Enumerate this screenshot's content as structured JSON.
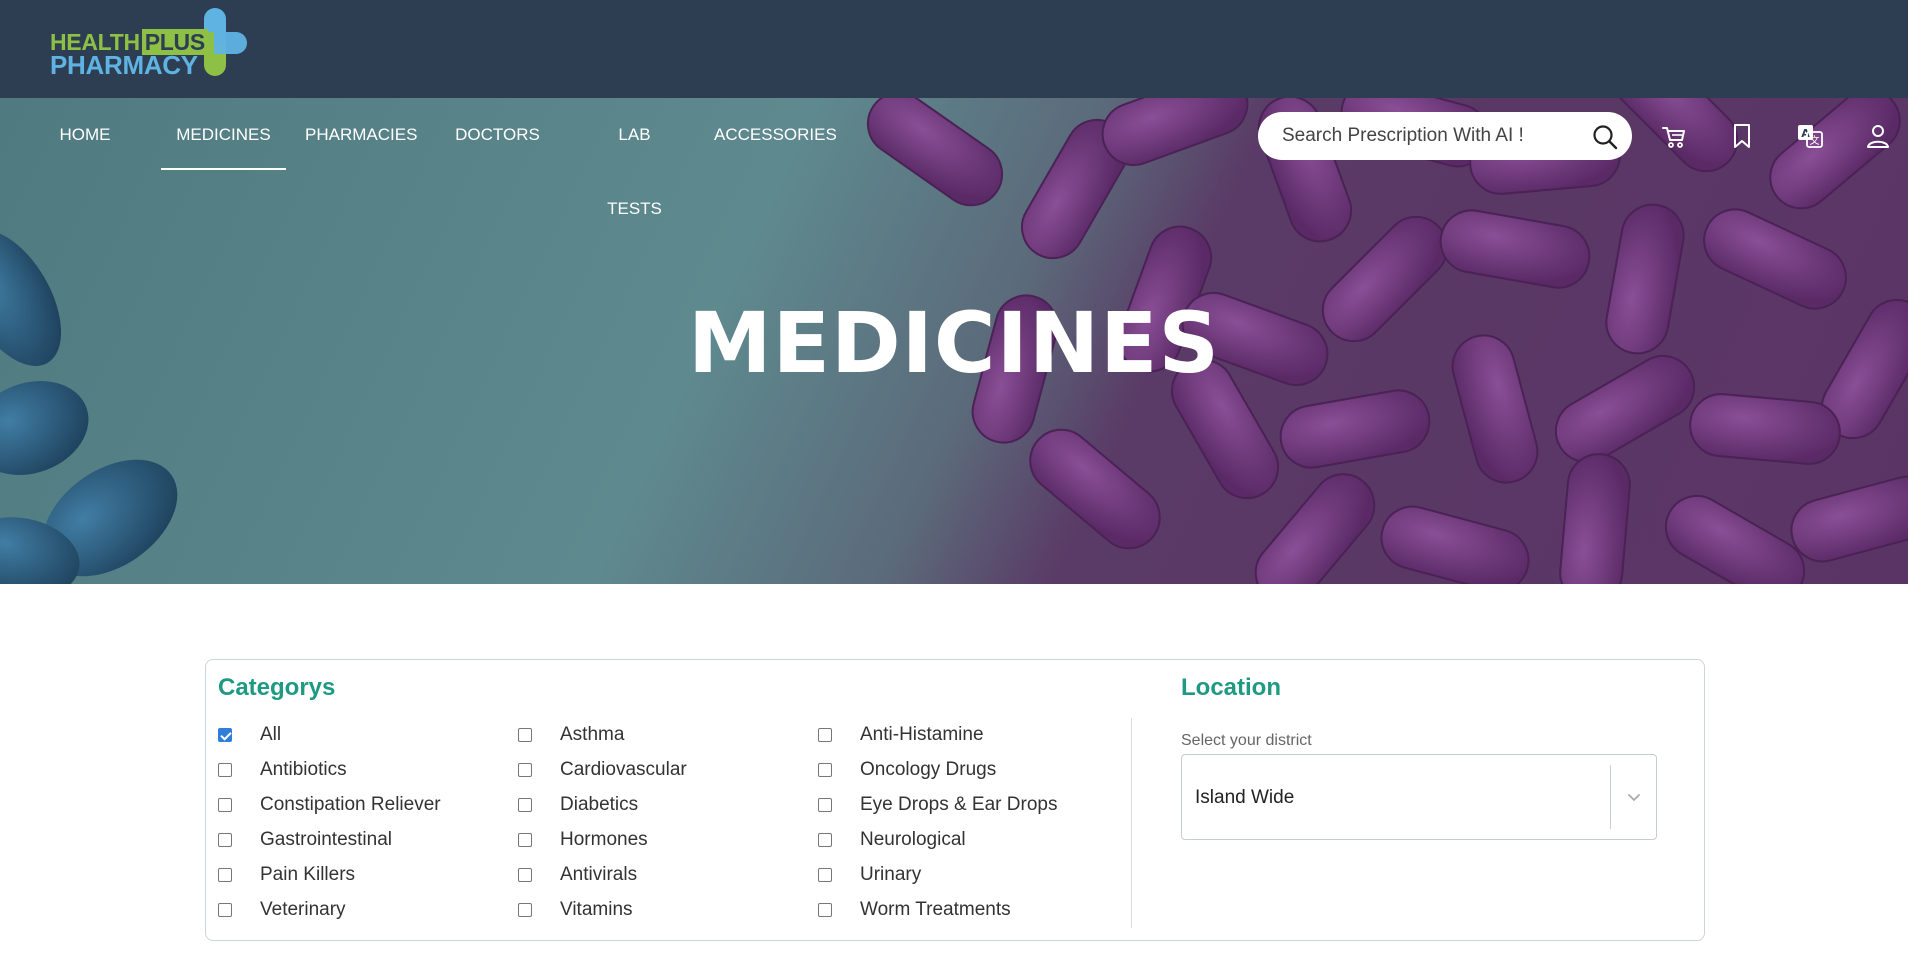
{
  "brand": {
    "line1": "HEALTH",
    "line1_box": "PLUS",
    "line2": "PHARMACY",
    "colors": {
      "green": "#8dc044",
      "blue": "#5fb3e3",
      "header_bg": "#2e3e52"
    }
  },
  "nav": {
    "items": [
      {
        "label": "HOME",
        "active": false
      },
      {
        "label": "MEDICINES",
        "active": true
      },
      {
        "label": "PHARMACIES",
        "active": false
      },
      {
        "label": "DOCTORS",
        "active": false
      },
      {
        "label": "LAB TESTS",
        "active": false
      },
      {
        "label": "ACCESSORIES",
        "active": false
      }
    ]
  },
  "search": {
    "placeholder": "Search Prescription With AI !",
    "icon": "search-icon"
  },
  "header_icons": [
    "cart-icon",
    "bookmark-icon",
    "translate-icon",
    "user-icon"
  ],
  "hero": {
    "title": "MEDICINES"
  },
  "filters": {
    "categories_title": "Categorys",
    "categories": [
      {
        "label": "All",
        "checked": true
      },
      {
        "label": "Antibiotics",
        "checked": false
      },
      {
        "label": "Constipation Reliever",
        "checked": false
      },
      {
        "label": "Gastrointestinal",
        "checked": false
      },
      {
        "label": "Pain Killers",
        "checked": false
      },
      {
        "label": "Veterinary",
        "checked": false
      },
      {
        "label": "Asthma",
        "checked": false
      },
      {
        "label": "Cardiovascular",
        "checked": false
      },
      {
        "label": "Diabetics",
        "checked": false
      },
      {
        "label": "Hormones",
        "checked": false
      },
      {
        "label": "Antivirals",
        "checked": false
      },
      {
        "label": "Vitamins",
        "checked": false
      },
      {
        "label": "Anti-Histamine",
        "checked": false
      },
      {
        "label": "Oncology Drugs",
        "checked": false
      },
      {
        "label": "Eye Drops & Ear Drops",
        "checked": false
      },
      {
        "label": "Neurological",
        "checked": false
      },
      {
        "label": "Urinary",
        "checked": false
      },
      {
        "label": "Worm Treatments",
        "checked": false
      }
    ],
    "location_title": "Location",
    "district_label": "Select your district",
    "district_value": "Island Wide"
  },
  "colors": {
    "accent": "#1e9a82",
    "checkbox_checked": "#2f7fd8"
  }
}
